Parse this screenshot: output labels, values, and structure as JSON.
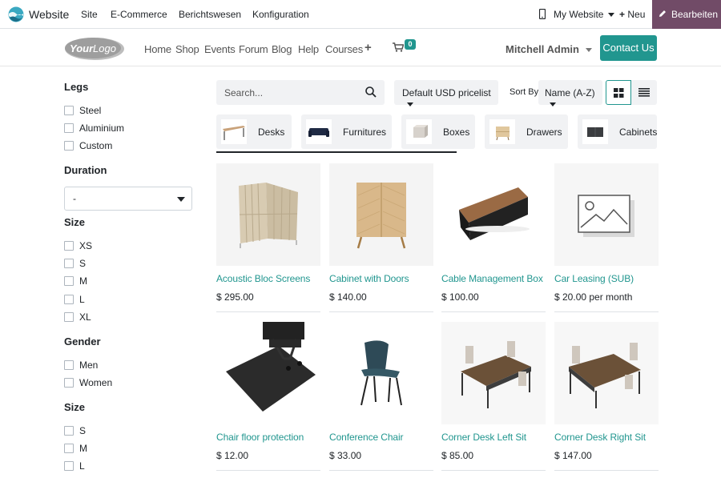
{
  "adminbar": {
    "app_name": "Website",
    "menu": [
      "Site",
      "E-Commerce",
      "Berichtswesen",
      "Konfiguration"
    ],
    "my_website": "My Website",
    "new": "Neu",
    "edit": "Bearbeiten"
  },
  "header": {
    "logo_text": "YourLogo",
    "nav": [
      "Home",
      "Shop",
      "Events",
      "Forum",
      "Blog",
      "Help",
      "Courses"
    ],
    "cart_count": "0",
    "user": "Mitchell Admin",
    "contact": "Contact Us"
  },
  "sidebar": {
    "legs": {
      "title": "Legs",
      "options": [
        "Steel",
        "Aluminium",
        "Custom"
      ]
    },
    "duration": {
      "title": "Duration",
      "value": "-"
    },
    "size": {
      "title": "Size",
      "options": [
        "XS",
        "S",
        "M",
        "L",
        "XL"
      ]
    },
    "gender": {
      "title": "Gender",
      "options": [
        "Men",
        "Women"
      ]
    },
    "size2": {
      "title": "Size",
      "options": [
        "S",
        "M",
        "L"
      ]
    }
  },
  "toolbar": {
    "search_placeholder": "Search...",
    "pricelist": "Default USD pricelist",
    "sort_label": "Sort By:",
    "sort_value": "Name (A-Z)"
  },
  "categories": [
    "Desks",
    "Furnitures",
    "Boxes",
    "Drawers",
    "Cabinets"
  ],
  "products": [
    {
      "name": "Acoustic Bloc Screens",
      "price": "$ 295.00",
      "suffix": ""
    },
    {
      "name": "Cabinet with Doors",
      "price": "$ 140.00",
      "suffix": ""
    },
    {
      "name": "Cable Management Box",
      "price": "$ 100.00",
      "suffix": ""
    },
    {
      "name": "Car Leasing (SUB)",
      "price": "$ 20.00",
      "suffix": " per month"
    },
    {
      "name": "Chair floor protection",
      "price": "$ 12.00",
      "suffix": ""
    },
    {
      "name": "Conference Chair",
      "price": "$ 33.00",
      "suffix": ""
    },
    {
      "name": "Corner Desk Left Sit",
      "price": "$ 85.00",
      "suffix": ""
    },
    {
      "name": "Corner Desk Right Sit",
      "price": "$ 147.00",
      "suffix": ""
    }
  ],
  "colors": {
    "primary": "#21968f",
    "odoo": "#714B67"
  }
}
